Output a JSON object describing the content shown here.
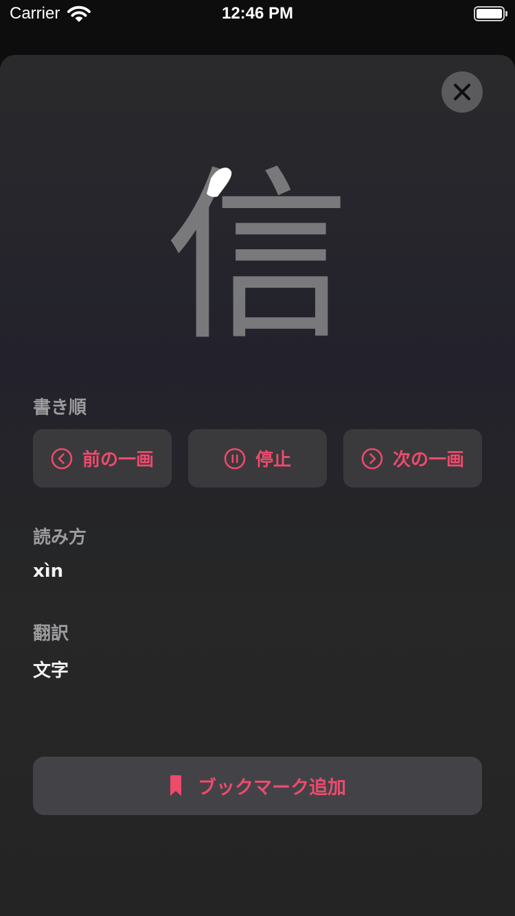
{
  "status_bar": {
    "carrier": "Carrier",
    "time": "12:46 PM"
  },
  "kanji": {
    "character": "信",
    "stroke_color": "#79797b",
    "active_stroke_color": "#ffffff"
  },
  "stroke_order": {
    "label": "書き順",
    "prev_label": "前の一画",
    "pause_label": "停止",
    "next_label": "次の一画"
  },
  "reading": {
    "label": "読み方",
    "value": "xìn"
  },
  "translation": {
    "label": "翻訳",
    "value": "文字"
  },
  "bookmark": {
    "label": "ブックマーク追加"
  },
  "colors": {
    "accent": "#ee4a6d",
    "button_bg": "#3a3a3c",
    "background": "#0c0d0c"
  },
  "icons": {
    "close": "close-icon",
    "prev": "chevron-left-circle-icon",
    "pause": "pause-circle-icon",
    "next": "chevron-right-circle-icon",
    "bookmark": "bookmark-icon",
    "wifi": "wifi-icon",
    "battery": "battery-icon"
  }
}
